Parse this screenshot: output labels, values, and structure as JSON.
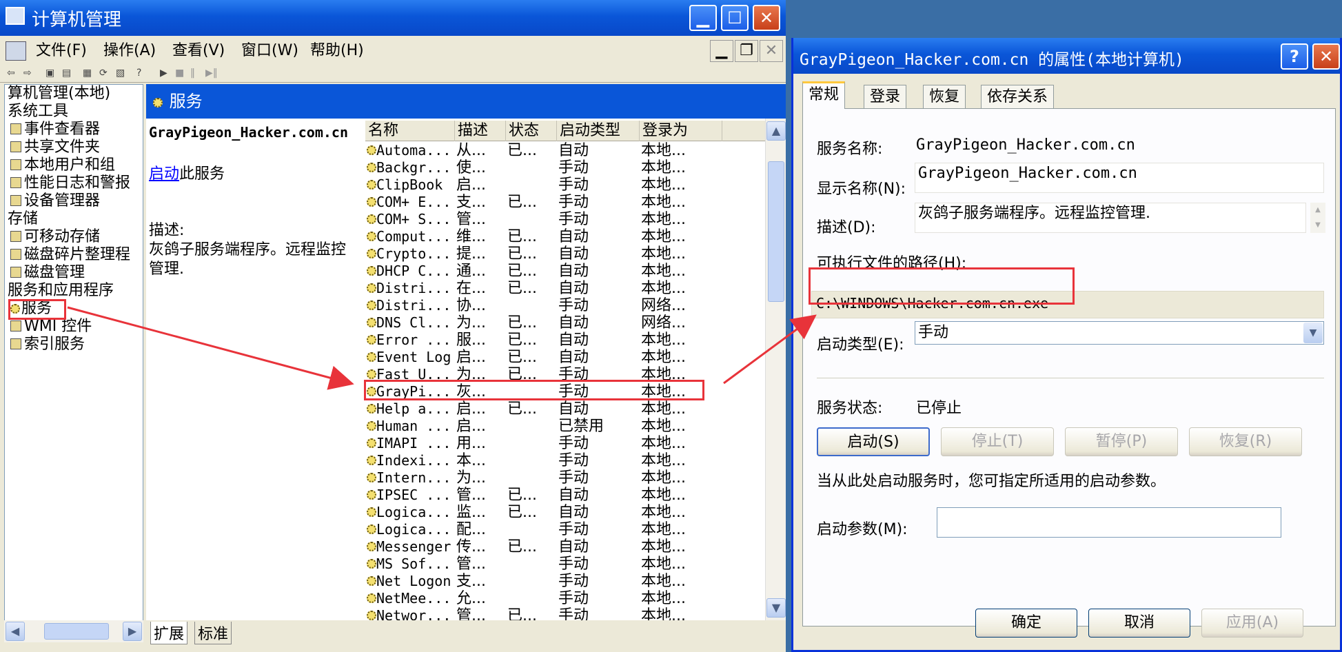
{
  "mmc": {
    "title": "计算机管理",
    "menu": [
      "文件(F)",
      "操作(A)",
      "查看(V)",
      "窗口(W)",
      "帮助(H)"
    ],
    "tree": [
      {
        "label": "算机管理(本地)",
        "indent": 0
      },
      {
        "label": "系统工具",
        "indent": 0
      },
      {
        "label": "事件查看器",
        "indent": 1
      },
      {
        "label": "共享文件夹",
        "indent": 1
      },
      {
        "label": "本地用户和组",
        "indent": 1
      },
      {
        "label": "性能日志和警报",
        "indent": 1
      },
      {
        "label": "设备管理器",
        "indent": 1
      },
      {
        "label": "存储",
        "indent": 0
      },
      {
        "label": "可移动存储",
        "indent": 1
      },
      {
        "label": "磁盘碎片整理程",
        "indent": 1
      },
      {
        "label": "磁盘管理",
        "indent": 1
      },
      {
        "label": "服务和应用程序",
        "indent": 0
      },
      {
        "label": "服务",
        "indent": 1
      },
      {
        "label": "WMI 控件",
        "indent": 1
      },
      {
        "label": "索引服务",
        "indent": 1
      }
    ],
    "services_header": "服务",
    "selected_service_name": "GrayPigeon_Hacker.com.cn",
    "start_link": "启动",
    "start_link_suffix": "此服务",
    "desc_label": "描述:",
    "desc_text_line1": "灰鸽子服务端程序。远程监控",
    "desc_text_line2": "管理.",
    "columns": [
      "名称",
      "描述",
      "状态",
      "启动类型",
      "登录为"
    ],
    "rows": [
      [
        "Automa...",
        "从...",
        "已...",
        "自动",
        "本地..."
      ],
      [
        "Backgr...",
        "使...",
        "",
        "手动",
        "本地..."
      ],
      [
        "ClipBook",
        "启...",
        "",
        "手动",
        "本地..."
      ],
      [
        "COM+ E...",
        "支...",
        "已...",
        "手动",
        "本地..."
      ],
      [
        "COM+ S...",
        "管...",
        "",
        "手动",
        "本地..."
      ],
      [
        "Comput...",
        "维...",
        "已...",
        "自动",
        "本地..."
      ],
      [
        "Crypto...",
        "提...",
        "已...",
        "自动",
        "本地..."
      ],
      [
        "DHCP C...",
        "通...",
        "已...",
        "自动",
        "本地..."
      ],
      [
        "Distri...",
        "在...",
        "已...",
        "自动",
        "本地..."
      ],
      [
        "Distri...",
        "协...",
        "",
        "手动",
        "网络..."
      ],
      [
        "DNS Cl...",
        "为...",
        "已...",
        "自动",
        "网络..."
      ],
      [
        "Error ...",
        "服...",
        "已...",
        "自动",
        "本地..."
      ],
      [
        "Event Log",
        "启...",
        "已...",
        "自动",
        "本地..."
      ],
      [
        "Fast U...",
        "为...",
        "已...",
        "手动",
        "本地..."
      ],
      [
        "GrayPi...",
        "灰...",
        "",
        "手动",
        "本地..."
      ],
      [
        "Help a...",
        "启...",
        "已...",
        "自动",
        "本地..."
      ],
      [
        "Human ...",
        "启...",
        "",
        "已禁用",
        "本地..."
      ],
      [
        "IMAPI ...",
        "用...",
        "",
        "手动",
        "本地..."
      ],
      [
        "Indexi...",
        "本...",
        "",
        "手动",
        "本地..."
      ],
      [
        "Intern...",
        "为...",
        "",
        "手动",
        "本地..."
      ],
      [
        "IPSEC ...",
        "管...",
        "已...",
        "自动",
        "本地..."
      ],
      [
        "Logica...",
        "监...",
        "已...",
        "自动",
        "本地..."
      ],
      [
        "Logica...",
        "配...",
        "",
        "手动",
        "本地..."
      ],
      [
        "Messenger",
        "传...",
        "已...",
        "自动",
        "本地..."
      ],
      [
        "MS Sof...",
        "管...",
        "",
        "手动",
        "本地..."
      ],
      [
        "Net Logon",
        "支...",
        "",
        "手动",
        "本地..."
      ],
      [
        "NetMee...",
        "允...",
        "",
        "手动",
        "本地..."
      ],
      [
        "Networ...",
        "管...",
        "已...",
        "手动",
        "本地..."
      ]
    ],
    "bottom_tabs": [
      "扩展",
      "标准"
    ]
  },
  "dialog": {
    "title": "GrayPigeon_Hacker.com.cn 的属性(本地计算机)",
    "help_btn": "?",
    "tabs": [
      "常规",
      "登录",
      "恢复",
      "依存关系"
    ],
    "service_name_label": "服务名称:",
    "service_name_value": "GrayPigeon_Hacker.com.cn",
    "display_name_label": "显示名称(N):",
    "display_name_value": "GrayPigeon_Hacker.com.cn",
    "desc_label": "描述(D):",
    "desc_value": "灰鸽子服务端程序。远程监控管理.",
    "path_label": "可执行文件的路径(H):",
    "path_value": "C:\\WINDOWS\\Hacker.com.cn.exe",
    "startup_type_label": "启动类型(E):",
    "startup_type_value": "手动",
    "status_label": "服务状态:",
    "status_value": "已停止",
    "btn_start": "启动(S)",
    "btn_stop": "停止(T)",
    "btn_pause": "暂停(P)",
    "btn_resume": "恢复(R)",
    "hint": "当从此处启动服务时，您可指定所适用的启动参数。",
    "params_label": "启动参数(M):",
    "params_value": "",
    "btn_ok": "确定",
    "btn_cancel": "取消",
    "btn_apply": "应用(A)"
  },
  "colors": {
    "highlight": "#e8333a",
    "title_blue": "#0a56d8",
    "link": "#0000ff"
  }
}
